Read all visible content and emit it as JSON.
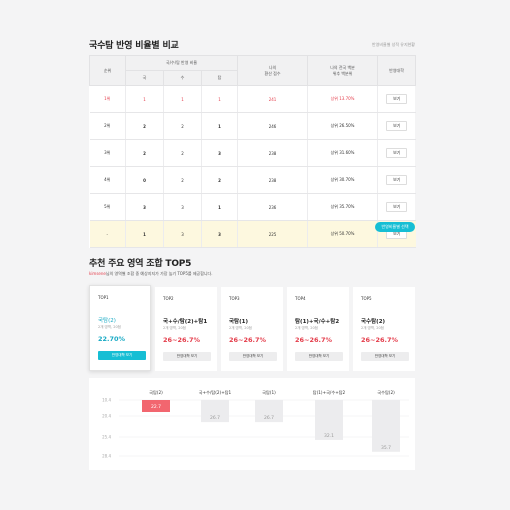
{
  "section1": {
    "title": "국수탐 반영 비율별 비교",
    "note": "반영비율별 성적 유지현황",
    "headers": {
      "rank": "순위",
      "group": "국/수/탐 반영 비율",
      "kor": "국",
      "math": "수",
      "inq": "탐",
      "my_score": "나의\n환산 점수",
      "my_pct": "나의 전국 백분\n위추 백분위",
      "action": "반영대학"
    },
    "rows": [
      {
        "rank": "1위",
        "kor": "1",
        "math": "1",
        "inq": "1",
        "score": "241",
        "pct": "상위 13.70%",
        "btn": "보기"
      },
      {
        "rank": "2위",
        "kor": "2",
        "math": "2",
        "inq": "1",
        "score": "246",
        "pct": "상위 26.50%",
        "btn": "보기"
      },
      {
        "rank": "3위",
        "kor": "2",
        "math": "2",
        "inq": "3",
        "score": "238",
        "pct": "상위 31.60%",
        "btn": "보기"
      },
      {
        "rank": "4위",
        "kor": "0",
        "math": "2",
        "inq": "2",
        "score": "238",
        "pct": "상위 30.70%",
        "btn": "보기"
      },
      {
        "rank": "5위",
        "kor": "3",
        "math": "3",
        "inq": "1",
        "score": "236",
        "pct": "상위 35.70%",
        "btn": "보기"
      },
      {
        "rank": "-",
        "kor": "1",
        "math": "3",
        "inq": "3",
        "score": "225",
        "pct": "상위 50.70%",
        "btn": "보기"
      }
    ],
    "compare_button": "반영비율별 선택"
  },
  "section2": {
    "title": "추천 주요 영역 조합 TOP5",
    "subtitle_highlight": "kimsene",
    "subtitle_rest": "님의 영역별 조합 중 예상지지가 가장 높기 TOP5를 제공합니다.",
    "cards": [
      {
        "rank": "TOP1",
        "name": "국탐(2)",
        "meta": "2개 영역, 20점",
        "rate": "22.70%",
        "btn": "반영대학 보기"
      },
      {
        "rank": "TOP2",
        "name": "국+수/탐(2)+탐1",
        "meta": "2개 영역, 20점",
        "rate": "26~26.7%",
        "btn": "반영대학 보기"
      },
      {
        "rank": "TOP3",
        "name": "국탐(1)",
        "meta": "2개 영역, 20점",
        "rate": "26~26.7%",
        "btn": "반영대학 보기"
      },
      {
        "rank": "TOP4",
        "name": "탐(1)+국/수+탐2",
        "meta": "2개 영역, 20점",
        "rate": "26~26.7%",
        "btn": "반영대학 보기"
      },
      {
        "rank": "TOP5",
        "name": "국수탐(2)",
        "meta": "2개 영역, 20점",
        "rate": "26~26.7%",
        "btn": "반영대학 보기"
      }
    ]
  },
  "chart_data": {
    "type": "bar",
    "categories": [
      "국탐(2)",
      "국+수/탐(2)+탐1",
      "국탐(1)",
      "탐(1)+국/수+탐2",
      "국수탐(2)"
    ],
    "values": [
      22.7,
      26.7,
      26.7,
      32.1,
      35.7
    ],
    "value_labels": [
      "22.7",
      "26.7",
      "26.7",
      "32.1",
      "35.7"
    ],
    "y_ticks": [
      "10.4",
      "20.4",
      "25.4",
      "28.4"
    ],
    "ylim": [
      20,
      40
    ],
    "colors": {
      "highlight": "#f2666f",
      "normal": "#ececee"
    }
  }
}
